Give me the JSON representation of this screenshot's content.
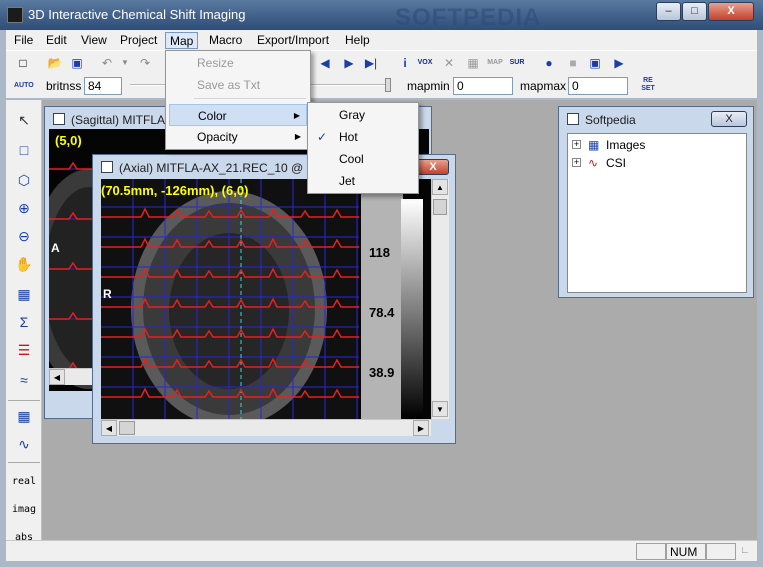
{
  "window": {
    "title": "3D Interactive Chemical Shift Imaging",
    "min": "–",
    "max": "□",
    "close": "X"
  },
  "menus": [
    "File",
    "Edit",
    "View",
    "Project",
    "Map",
    "Macro",
    "Export/Import",
    "Help"
  ],
  "active_menu": "Map",
  "map_menu": {
    "items": [
      {
        "label": "Resize",
        "disabled": true
      },
      {
        "label": "Save as Txt",
        "disabled": true
      },
      {
        "label": "Color",
        "submenu": true
      },
      {
        "label": "Opacity",
        "submenu": true
      }
    ]
  },
  "color_submenu": {
    "items": [
      "Gray",
      "Hot",
      "Cool",
      "Jet"
    ],
    "checked": "Hot"
  },
  "toolbar2": {
    "auto_label": "AUTO",
    "britnss_label": "britnss",
    "britnss_value": "84",
    "mapmin_label": "mapmin",
    "mapmin_value": "0",
    "mapmax_label": "mapmax",
    "mapmax_value": "0",
    "reset_label": "RE SET"
  },
  "toolbar1": {
    "vox": "VOX",
    "map": "MAP",
    "sur": "SUR"
  },
  "palette_text": [
    "real",
    "imag",
    "abs"
  ],
  "sagittal": {
    "title": "(Sagittal) MITFLA-",
    "coord": "(5,0)",
    "label_a": "A"
  },
  "axial": {
    "title": "(Axial) MITFLA-AX_21.REC_10 @ 10",
    "coord": "(70.5mm, -126mm), (6,0)",
    "label_r": "R",
    "scale": [
      "118",
      "78.4",
      "38.9"
    ]
  },
  "softpedia": {
    "title": "Softpedia",
    "close": "X",
    "tree": [
      "Images",
      "CSI"
    ]
  },
  "status": {
    "num": "NUM"
  },
  "watermark": "SOFTPEDIA",
  "colors": {
    "trace": "#e81f1f",
    "grid": "#2727d9",
    "coord_text": "#ffff00"
  }
}
